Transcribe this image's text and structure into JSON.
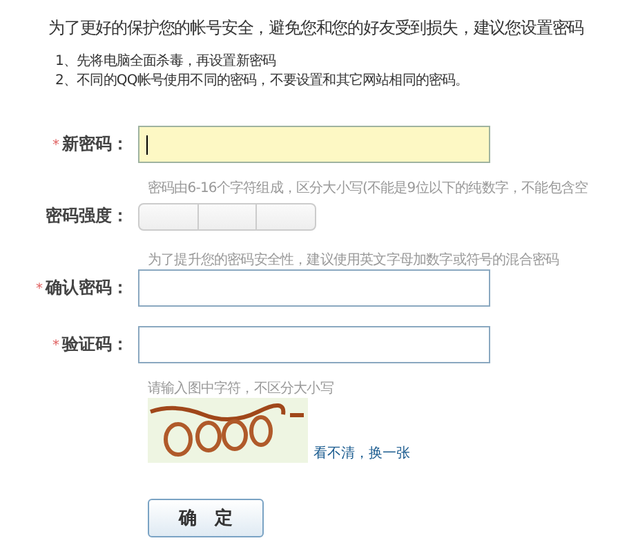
{
  "heading": "为了更好的保护您的帐号安全，避免您和您的好友受到损失，建议您设置密码",
  "notes": [
    "1、先将电脑全面杀毒，再设置新密码",
    "2、不同的QQ帐号使用不同的密码，不要设置和其它网站相同的密码。"
  ],
  "rows": [
    {
      "kind": "field",
      "label": "新密码：",
      "mark": "*",
      "focused": true,
      "hint": "密码由6-16个字符组成，区分大小写(不能是9位以下的纯数字，不能包含空"
    },
    {
      "kind": "meter",
      "label": "密码强度：",
      "hint": "为了提升您的密码安全性，建议使用英文字母加数字或符号的混合密码"
    },
    {
      "kind": "field",
      "label": "确认密码：",
      "mark": "*",
      "focused": false
    },
    {
      "kind": "field",
      "label": "验证码：",
      "mark": "*",
      "focused": false,
      "hint": "请输入图中字符，不区分大小写"
    },
    {
      "kind": "captcha",
      "link": "看不清，换一张"
    }
  ],
  "submit": "确　定"
}
